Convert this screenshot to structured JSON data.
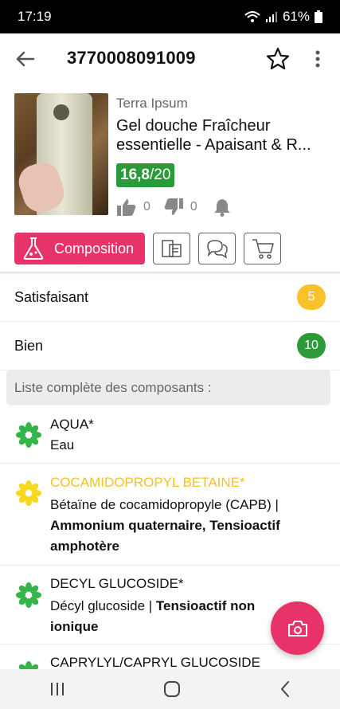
{
  "status_bar": {
    "time": "17:19",
    "battery": "61%"
  },
  "app_bar": {
    "title": "3770008091009"
  },
  "product": {
    "brand": "Terra Ipsum",
    "name_line1": "Gel douche Fraîcheur",
    "name_line2": "essentielle - Apaisant & R...",
    "score_value": "16,8",
    "score_max": "/20",
    "likes": "0",
    "dislikes": "0"
  },
  "actions": {
    "composition_label": "Composition"
  },
  "summary": [
    {
      "label": "Satisfaisant",
      "count": "5",
      "color": "#f9c22b"
    },
    {
      "label": "Bien",
      "count": "10",
      "color": "#2b9b3a"
    }
  ],
  "list_header": "Liste complète des composants :",
  "ingredients": [
    {
      "name": "AQUA*",
      "name_color": "#111111",
      "icon_color": "#35b44a",
      "desc": "Eau",
      "bold": ""
    },
    {
      "name": "COCAMIDOPROPYL BETAINE*",
      "name_color": "#f4c227",
      "icon_color": "#f9d71c",
      "desc": "Bétaïne de cocamidopropyle (CAPB) | ",
      "bold": "Ammonium quaternaire, Tensioactif amphotère"
    },
    {
      "name": "DECYL GLUCOSIDE*",
      "name_color": "#111111",
      "icon_color": "#35b44a",
      "desc": "Décyl glucoside | ",
      "bold": "Tensioactif non ionique"
    },
    {
      "name": "CAPRYLYL/CAPRYL GLUCOSIDE",
      "name_color": "#111111",
      "icon_color": "#35b44a",
      "desc": "",
      "bold": ""
    }
  ],
  "colors": {
    "accent": "#e8336a",
    "good": "#2b9b3a",
    "ok": "#f9c22b"
  }
}
